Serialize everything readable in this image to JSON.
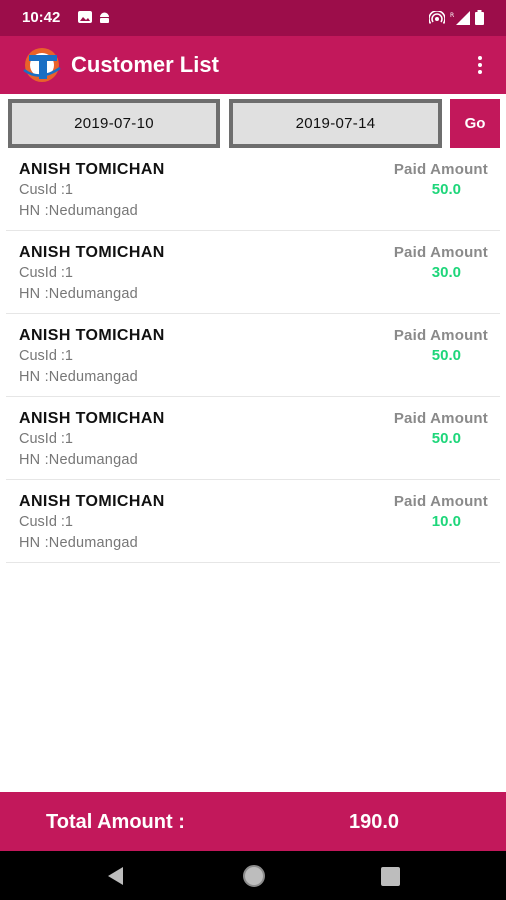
{
  "status_bar": {
    "time": "10:42",
    "left_icons": [
      "gallery-icon",
      "android-icon"
    ],
    "right_icons": [
      "hotspot-icon",
      "signal-icon",
      "battery-icon"
    ]
  },
  "app_bar": {
    "title": "Customer List",
    "logo_icon": "app-logo-icon",
    "menu_icon": "more-vert-icon"
  },
  "filter": {
    "from_date": "2019-07-10",
    "to_date": "2019-07-14",
    "go_label": "Go"
  },
  "customers": [
    {
      "name": "ANISH TOMICHAN",
      "cusid": "CusId :1",
      "hn": "HN :Nedumangad",
      "paid_label": "Paid Amount",
      "amount": "50.0"
    },
    {
      "name": "ANISH TOMICHAN",
      "cusid": "CusId :1",
      "hn": "HN :Nedumangad",
      "paid_label": "Paid Amount",
      "amount": "30.0"
    },
    {
      "name": "ANISH TOMICHAN",
      "cusid": "CusId :1",
      "hn": "HN :Nedumangad",
      "paid_label": "Paid Amount",
      "amount": "50.0"
    },
    {
      "name": "ANISH TOMICHAN",
      "cusid": "CusId :1",
      "hn": "HN :Nedumangad",
      "paid_label": "Paid Amount",
      "amount": "50.0"
    },
    {
      "name": "ANISH TOMICHAN",
      "cusid": "CusId :1",
      "hn": "HN :Nedumangad",
      "paid_label": "Paid Amount",
      "amount": "10.0"
    }
  ],
  "total": {
    "label": "Total Amount :",
    "value": "190.0"
  },
  "colors": {
    "primary": "#c2185b",
    "status_bar": "#9c0d4a",
    "amount": "#1ed67a"
  },
  "nav": {
    "icons": [
      "back-icon",
      "home-icon",
      "recents-icon"
    ]
  }
}
